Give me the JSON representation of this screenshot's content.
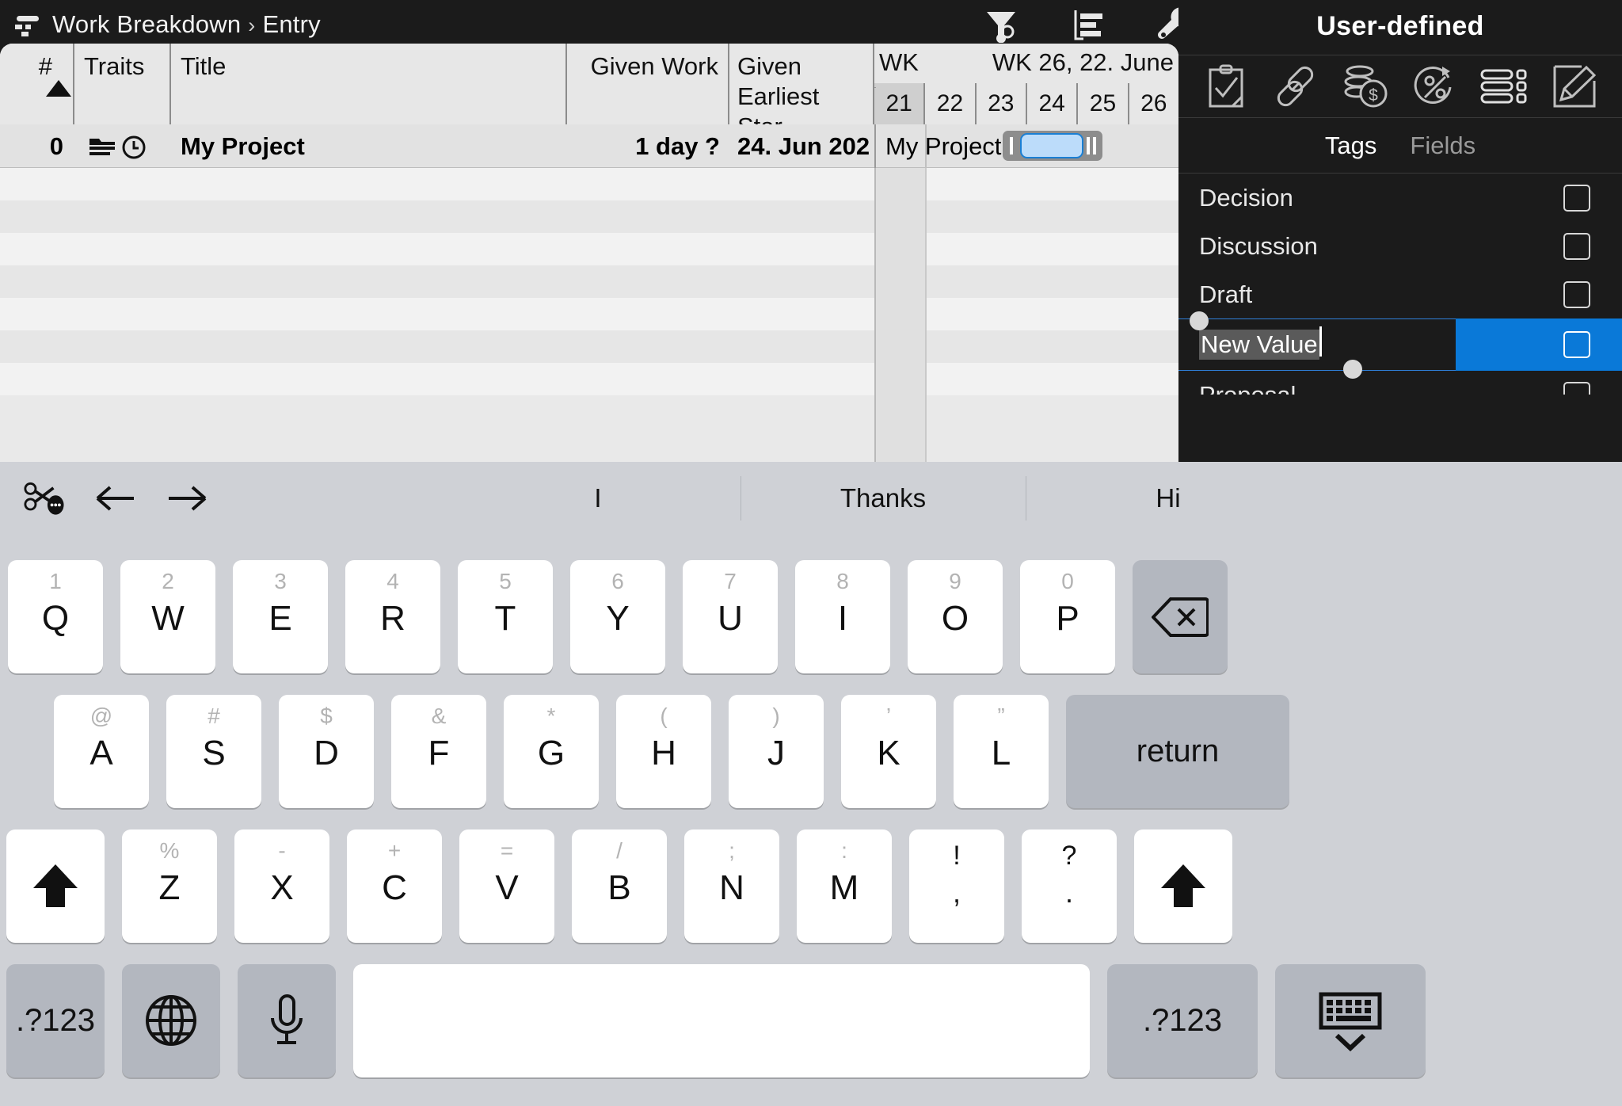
{
  "topbar": {
    "app_icon": "app-logo-icon",
    "breadcrumb_root": "Work Breakdown",
    "breadcrumb_sep": "›",
    "breadcrumb_current": "Entry",
    "icons": [
      {
        "name": "filter-icon",
        "label": "Filter"
      },
      {
        "name": "outline-icon",
        "label": "Outline"
      },
      {
        "name": "wrench-icon",
        "label": "Tools"
      }
    ]
  },
  "sheet": {
    "columns": [
      {
        "key": "num",
        "header": "#",
        "sort": "ascending"
      },
      {
        "key": "traits",
        "header": "Traits"
      },
      {
        "key": "title",
        "header": "Title"
      },
      {
        "key": "given_work",
        "header": "Given Work"
      },
      {
        "key": "given_earliest_start",
        "header": "Given Earliest Star"
      }
    ],
    "rows": [
      {
        "num": "0",
        "traits_icons": [
          "folder-icon",
          "clock-icon"
        ],
        "title": "My Project",
        "given_work": "1 day ?",
        "given_earliest_start": "24. Jun 202",
        "gantt_label": "My Project"
      }
    ],
    "gantt": {
      "week_left_label": "WK",
      "week_main_label": "WK 26, 22. June",
      "days": [
        "21",
        "22",
        "23",
        "24",
        "25",
        "26"
      ],
      "today_column": "21",
      "bar_color": "#bcdcfa",
      "bar_border_color": "#1a7fd4"
    }
  },
  "panel": {
    "title": "User-defined",
    "icons": [
      {
        "name": "clipboard-check-icon",
        "label": "Checklist"
      },
      {
        "name": "link-icon",
        "label": "Links"
      },
      {
        "name": "money-stack-icon",
        "label": "Costs"
      },
      {
        "name": "percent-progress-icon",
        "label": "Progress"
      },
      {
        "name": "list-icon",
        "label": "List"
      },
      {
        "name": "pencil-edit-icon",
        "label": "Edit"
      }
    ],
    "tabs": [
      {
        "label": "Tags",
        "active": true
      },
      {
        "label": "Fields",
        "active": false
      }
    ],
    "tags": [
      {
        "label": "Decision",
        "checked": false
      },
      {
        "label": "Discussion",
        "checked": false
      },
      {
        "label": "Draft",
        "checked": false
      },
      {
        "label": "New Value",
        "checked": false,
        "editing": true,
        "selected": true
      },
      {
        "label": "Proposal",
        "checked": false,
        "clipped": true
      }
    ],
    "accent_color": "#0a79d8",
    "selection_color": "#5a5a5a"
  },
  "keyboard": {
    "tools": [
      {
        "name": "scissors-more-icon",
        "label": "Cut options"
      },
      {
        "name": "arrow-left-icon",
        "label": "Undo"
      },
      {
        "name": "arrow-right-icon",
        "label": "Redo"
      }
    ],
    "suggestions": [
      "I",
      "Thanks",
      "Hi"
    ],
    "row1": [
      {
        "alt": "1",
        "main": "Q"
      },
      {
        "alt": "2",
        "main": "W"
      },
      {
        "alt": "3",
        "main": "E"
      },
      {
        "alt": "4",
        "main": "R"
      },
      {
        "alt": "5",
        "main": "T"
      },
      {
        "alt": "6",
        "main": "Y"
      },
      {
        "alt": "7",
        "main": "U"
      },
      {
        "alt": "8",
        "main": "I"
      },
      {
        "alt": "9",
        "main": "O"
      },
      {
        "alt": "0",
        "main": "P"
      }
    ],
    "backspace": {
      "name": "backspace-icon",
      "label": "Backspace"
    },
    "row2": [
      {
        "alt": "@",
        "main": "A"
      },
      {
        "alt": "#",
        "main": "S"
      },
      {
        "alt": "$",
        "main": "D"
      },
      {
        "alt": "&",
        "main": "F"
      },
      {
        "alt": "*",
        "main": "G"
      },
      {
        "alt": "(",
        "main": "H"
      },
      {
        "alt": ")",
        "main": "J"
      },
      {
        "alt": "’",
        "main": "K"
      },
      {
        "alt": "”",
        "main": "L"
      }
    ],
    "return_label": "return",
    "row3": [
      {
        "alt": "%",
        "main": "Z"
      },
      {
        "alt": "-",
        "main": "X"
      },
      {
        "alt": "+",
        "main": "C"
      },
      {
        "alt": "=",
        "main": "V"
      },
      {
        "alt": "/",
        "main": "B"
      },
      {
        "alt": ";",
        "main": "N"
      },
      {
        "alt": ":",
        "main": "M"
      },
      {
        "alt": "!",
        "main": ",",
        "dark": true
      },
      {
        "alt": "?",
        "main": ".",
        "dark": true
      }
    ],
    "shift_left": {
      "name": "shift-icon",
      "label": "Shift"
    },
    "shift_right": {
      "name": "shift-icon",
      "label": "Shift"
    },
    "row4": {
      "numbers_left": ".?123",
      "globe": {
        "name": "globe-icon",
        "label": "Change keyboard"
      },
      "mic": {
        "name": "microphone-icon",
        "label": "Dictate"
      },
      "space": "",
      "numbers_right": ".?123",
      "dismiss": {
        "name": "keyboard-dismiss-icon",
        "label": "Hide keyboard"
      }
    }
  }
}
